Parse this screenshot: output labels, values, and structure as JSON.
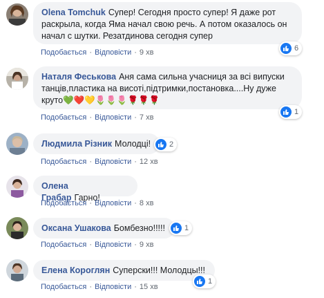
{
  "actions": {
    "like": "Подобається",
    "reply": "Відповісти",
    "separator": "·"
  },
  "colors": {
    "link": "#385898",
    "bubble": "#f2f3f5",
    "like_blue": "#1877f2",
    "meta": "#606770"
  },
  "comments": [
    {
      "author": "Olena Tomchuk",
      "text": "Супер! Сегодня просто супер! Я даже рот раскрыла, когда Яма начал свою речь. А потом оказалось он начал с шутки. Резатдинова сегодня супер",
      "time": "9 хв",
      "reactions": "6",
      "reaction_icon": "like-icon"
    },
    {
      "author": "Наталя Феськова",
      "text": "Аня сама сильна учасниця за всі випуски танців,пластика на висоті,підтримки,постановка....Ну дуже круто",
      "emoji_tail": "💚❤️💛🌷🌷🌷🌹🌹🌹",
      "time": "7 хв",
      "reactions": "1",
      "reaction_icon": "like-icon"
    },
    {
      "author": "Людмила Різник",
      "text": "Молодці!",
      "time": "12 хв",
      "reactions": "2",
      "reaction_icon": "like-icon"
    },
    {
      "author": "Олена Грабар",
      "text": "Гарно!",
      "time": "8 хв",
      "reactions": "",
      "reaction_icon": ""
    },
    {
      "author": "Оксана Ушакова",
      "text": "Бомбезно!!!!!",
      "time": "9 хв",
      "reactions": "1",
      "reaction_icon": "like-icon"
    },
    {
      "author": "Елена Короглян",
      "text": "Суперски!!! Молодцы!!!",
      "time": "15 хв",
      "reactions": "1",
      "reaction_icon": "like-icon"
    }
  ]
}
